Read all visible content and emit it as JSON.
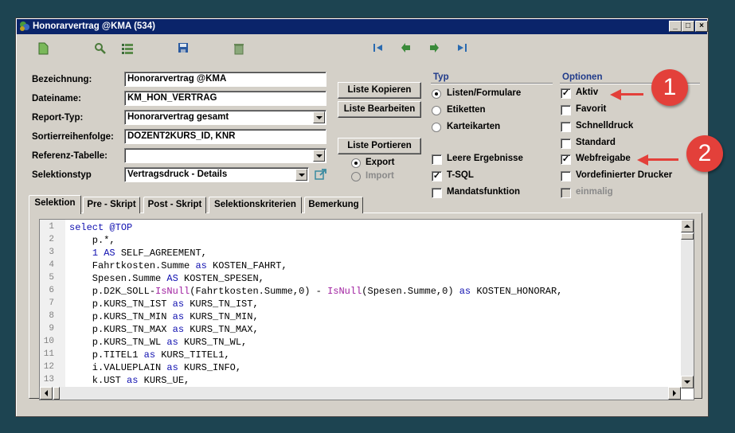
{
  "window": {
    "title": "Honorarvertrag @KMA (534)"
  },
  "titlebar_buttons": {
    "minimize": "_",
    "maximize": "□",
    "close": "×"
  },
  "toolbar": [
    {
      "name": "new-document-icon",
      "color": "#6aa84f"
    },
    {
      "name": "search-icon",
      "color": "#4a7a3a"
    },
    {
      "name": "list-icon",
      "color": "#3a6a3a"
    },
    {
      "name": "save-icon",
      "color": "#2a5aa0"
    },
    {
      "name": "delete-icon",
      "color": "#6a8a5a"
    },
    {
      "name": "first-record-icon",
      "color": "#2a6ab0"
    },
    {
      "name": "previous-record-icon",
      "color": "#3a8a3a"
    },
    {
      "name": "next-record-icon",
      "color": "#3a8a3a"
    },
    {
      "name": "last-record-icon",
      "color": "#2a6ab0"
    }
  ],
  "form": {
    "bezeichnung": {
      "label": "Bezeichnung:",
      "value": "Honorarvertrag @KMA"
    },
    "dateiname": {
      "label": "Dateiname:",
      "value": "KM_HON_VERTRAG"
    },
    "report_typ": {
      "label": "Report-Typ:",
      "value": "Honorarvertrag gesamt"
    },
    "sortierreihenfolge": {
      "label": "Sortierreihenfolge:",
      "value": "DOZENT2KURS_ID, KNR"
    },
    "referenz_tabelle": {
      "label": "Referenz-Tabelle:",
      "value": ""
    },
    "selektionstyp": {
      "label": "Selektionstyp",
      "value": "Vertragsdruck - Details"
    }
  },
  "buttons": {
    "liste_kopieren": "Liste Kopieren",
    "liste_bearbeiten": "Liste Bearbeiten",
    "liste_portieren": "Liste Portieren"
  },
  "portieren": {
    "export": "Export",
    "import": "Import"
  },
  "typ": {
    "title": "Typ",
    "radios": [
      "Listen/Formulare",
      "Etiketten",
      "Karteikarten"
    ],
    "checks": [
      {
        "label": "Leere Ergebnisse",
        "checked": false
      },
      {
        "label": "T-SQL",
        "checked": true
      },
      {
        "label": "Mandatsfunktion",
        "checked": false
      }
    ]
  },
  "optionen": {
    "title": "Optionen",
    "checks": [
      {
        "label": "Aktiv",
        "checked": true
      },
      {
        "label": "Favorit",
        "checked": false
      },
      {
        "label": "Schnelldruck",
        "checked": false
      },
      {
        "label": "Standard",
        "checked": false
      },
      {
        "label": "Webfreigabe",
        "checked": true
      },
      {
        "label": "Vordefinierter Drucker",
        "checked": false
      },
      {
        "label": "einmalig",
        "checked": false,
        "disabled": true
      }
    ]
  },
  "check_mark": "✓",
  "tabs": [
    "Selektion",
    "Pre - Skript",
    "Post - Skript",
    "Selektionskriterien",
    "Bemerkung"
  ],
  "code_lines": [
    [
      [
        "kw",
        "select "
      ],
      [
        "kw",
        "@TOP"
      ]
    ],
    [
      [
        "",
        "    p.*,"
      ]
    ],
    [
      [
        "",
        "    "
      ],
      [
        "kw",
        "1 AS"
      ],
      [
        "",
        " SELF_AGREEMENT,"
      ]
    ],
    [
      [
        "",
        "    Fahrtkosten.Summe "
      ],
      [
        "kw",
        "as"
      ],
      [
        "",
        " KOSTEN_FAHRT,"
      ]
    ],
    [
      [
        "",
        "    Spesen.Summe "
      ],
      [
        "kw",
        "AS"
      ],
      [
        "",
        " KOSTEN_SPESEN,"
      ]
    ],
    [
      [
        "",
        "    p.D2K_SOLL-"
      ],
      [
        "fn",
        "IsNull"
      ],
      [
        "",
        "(Fahrtkosten.Summe,0) - "
      ],
      [
        "fn",
        "IsNull"
      ],
      [
        "",
        "(Spesen.Summe,0) "
      ],
      [
        "kw",
        "as"
      ],
      [
        "",
        " KOSTEN_HONORAR,"
      ]
    ],
    [
      [
        "",
        "    p.KURS_TN_IST "
      ],
      [
        "kw",
        "as"
      ],
      [
        "",
        " KURS_TN_IST,"
      ]
    ],
    [
      [
        "",
        "    p.KURS_TN_MIN "
      ],
      [
        "kw",
        "as"
      ],
      [
        "",
        " KURS_TN_MIN,"
      ]
    ],
    [
      [
        "",
        "    p.KURS_TN_MAX "
      ],
      [
        "kw",
        "as"
      ],
      [
        "",
        " KURS_TN_MAX,"
      ]
    ],
    [
      [
        "",
        "    p.KURS_TN_WL "
      ],
      [
        "kw",
        "as"
      ],
      [
        "",
        " KURS_TN_WL,"
      ]
    ],
    [
      [
        "",
        "    p.TITEL1 "
      ],
      [
        "kw",
        "as"
      ],
      [
        "",
        " KURS_TITEL1,"
      ]
    ],
    [
      [
        "",
        "    i.VALUEPLAIN "
      ],
      [
        "kw",
        "as"
      ],
      [
        "",
        " KURS_INFO,"
      ]
    ],
    [
      [
        "",
        "    k.UST "
      ],
      [
        "kw",
        "as"
      ],
      [
        "",
        " KURS_UE,"
      ]
    ]
  ],
  "annotations": [
    "1",
    "2"
  ],
  "colors": {
    "accent": "#e3403a",
    "titlebar": "#0a246a",
    "group_title": "#1f3a8a",
    "background": "#1d4451"
  }
}
